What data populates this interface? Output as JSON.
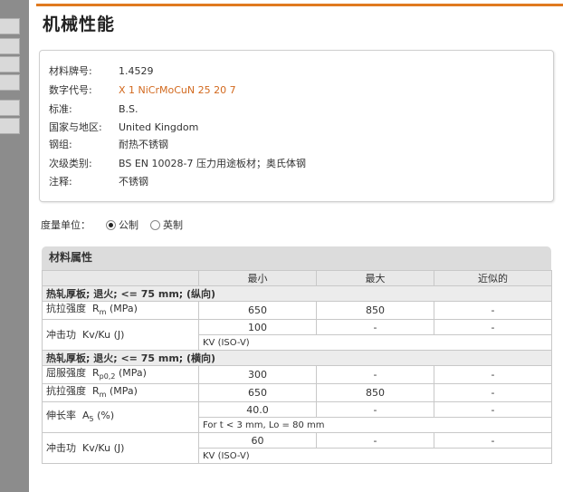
{
  "page_title": "机械性能",
  "info": [
    {
      "label": "材料牌号:",
      "value": "1.4529",
      "orange": false
    },
    {
      "label": "数字代号:",
      "value": "X 1 NiCrMoCuN 25 20 7",
      "orange": true
    },
    {
      "label": "标准:",
      "value": "B.S.",
      "orange": false
    },
    {
      "label": "国家与地区:",
      "value": "United Kingdom",
      "orange": false
    },
    {
      "label": "钢组:",
      "value": "耐热不锈钢",
      "orange": false
    },
    {
      "label": "次级类别:",
      "value": "BS EN 10028-7 压力用途板材；奥氏体钢",
      "orange": false
    },
    {
      "label": "注释:",
      "value": "不锈钢",
      "orange": false
    }
  ],
  "units": {
    "label": "度量单位：",
    "options": [
      {
        "label": "公制",
        "checked": true
      },
      {
        "label": "英制",
        "checked": false
      }
    ]
  },
  "props": {
    "title": "材料属性",
    "columns": [
      "最小",
      "最大",
      "近似的"
    ],
    "groups": [
      {
        "title": "热轧厚板; 退火; <= 75 mm; (纵向)",
        "rows": [
          {
            "name": "抗拉强度",
            "symbol": "R",
            "sub": "m",
            "unit": "(MPa)",
            "min": "650",
            "max": "850",
            "approx": "-"
          },
          {
            "name": "冲击功",
            "symbol": "Kv/Ku",
            "sub": "",
            "unit": "(J)",
            "min": "100",
            "max": "-",
            "approx": "-",
            "note": "KV (ISO-V)"
          }
        ]
      },
      {
        "title": "热轧厚板; 退火; <= 75 mm; (横向)",
        "rows": [
          {
            "name": "屈服强度",
            "symbol": "R",
            "sub": "p0,2",
            "unit": "(MPa)",
            "min": "300",
            "max": "-",
            "approx": "-"
          },
          {
            "name": "抗拉强度",
            "symbol": "R",
            "sub": "m",
            "unit": "(MPa)",
            "min": "650",
            "max": "850",
            "approx": "-"
          },
          {
            "name": "伸长率",
            "symbol": "A",
            "sub": "5",
            "unit": "(%)",
            "min": "40.0",
            "max": "-",
            "approx": "-",
            "note": "For t < 3 mm, Lo = 80 mm"
          },
          {
            "name": "冲击功",
            "symbol": "Kv/Ku",
            "sub": "",
            "unit": "(J)",
            "min": "60",
            "max": "-",
            "approx": "-",
            "note": "KV (ISO-V)"
          }
        ]
      }
    ]
  },
  "colors": {
    "accent": "#e07a1f",
    "orange_text": "#d2691e",
    "sidebar": "#8c8c8c"
  }
}
